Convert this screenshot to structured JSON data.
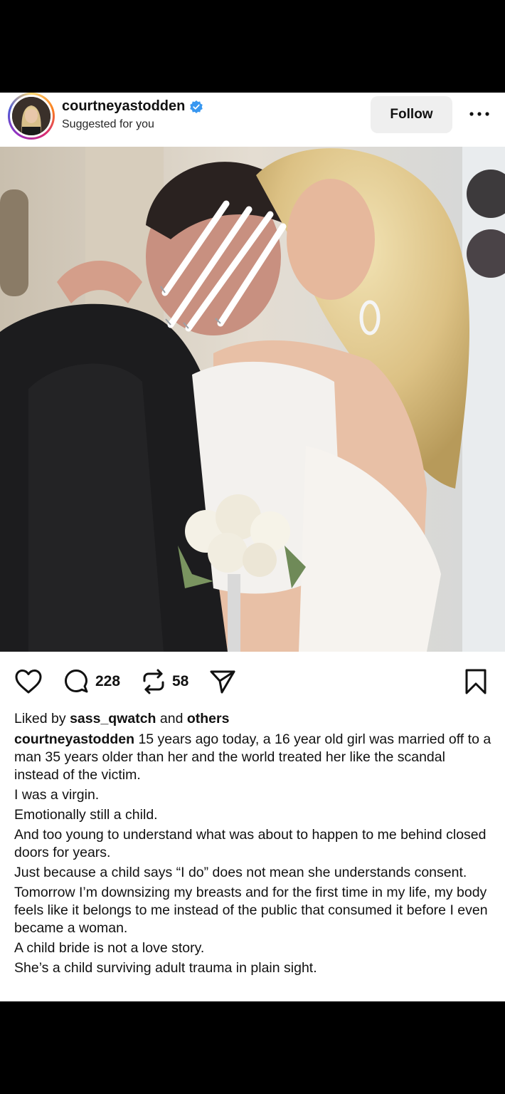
{
  "post": {
    "username": "courtneyastodden",
    "subtitle": "Suggested for you",
    "follow_label": "Follow",
    "verified": true
  },
  "actions": {
    "comments_count": "228",
    "reposts_count": "58"
  },
  "likes": {
    "prefix": "Liked by",
    "user": "sass_qwatch",
    "joiner": "and",
    "others": "others"
  },
  "caption": {
    "username": "courtneyastodden",
    "first_line": "15 years ago today, a 16 year old girl was married off to a man 35 years older than her and the world treated her like the scandal instead of the victim.",
    "lines": [
      "I was a virgin.",
      "Emotionally still a child.",
      "And too young to understand what was about to happen to me behind closed doors for years.",
      "Just because a child says “I do” does not mean she understands consent.",
      "Tomorrow I’m downsizing my breasts and for the first time in my life, my body feels like it belongs to me instead of the public that consumed it before I even became a woman.",
      "A child bride is not a love story.",
      "She’s a child surviving adult trauma in plain sight."
    ]
  },
  "icons": {
    "verified": "verified-badge-icon",
    "more": "more-options-icon",
    "like": "heart-icon",
    "comment": "comment-icon",
    "repost": "repost-icon",
    "share": "send-icon",
    "save": "bookmark-icon",
    "mute": "muted-speaker-icon"
  },
  "colors": {
    "verified_blue": "#3897f0",
    "follow_bg": "#efefef",
    "background": "#000000"
  }
}
